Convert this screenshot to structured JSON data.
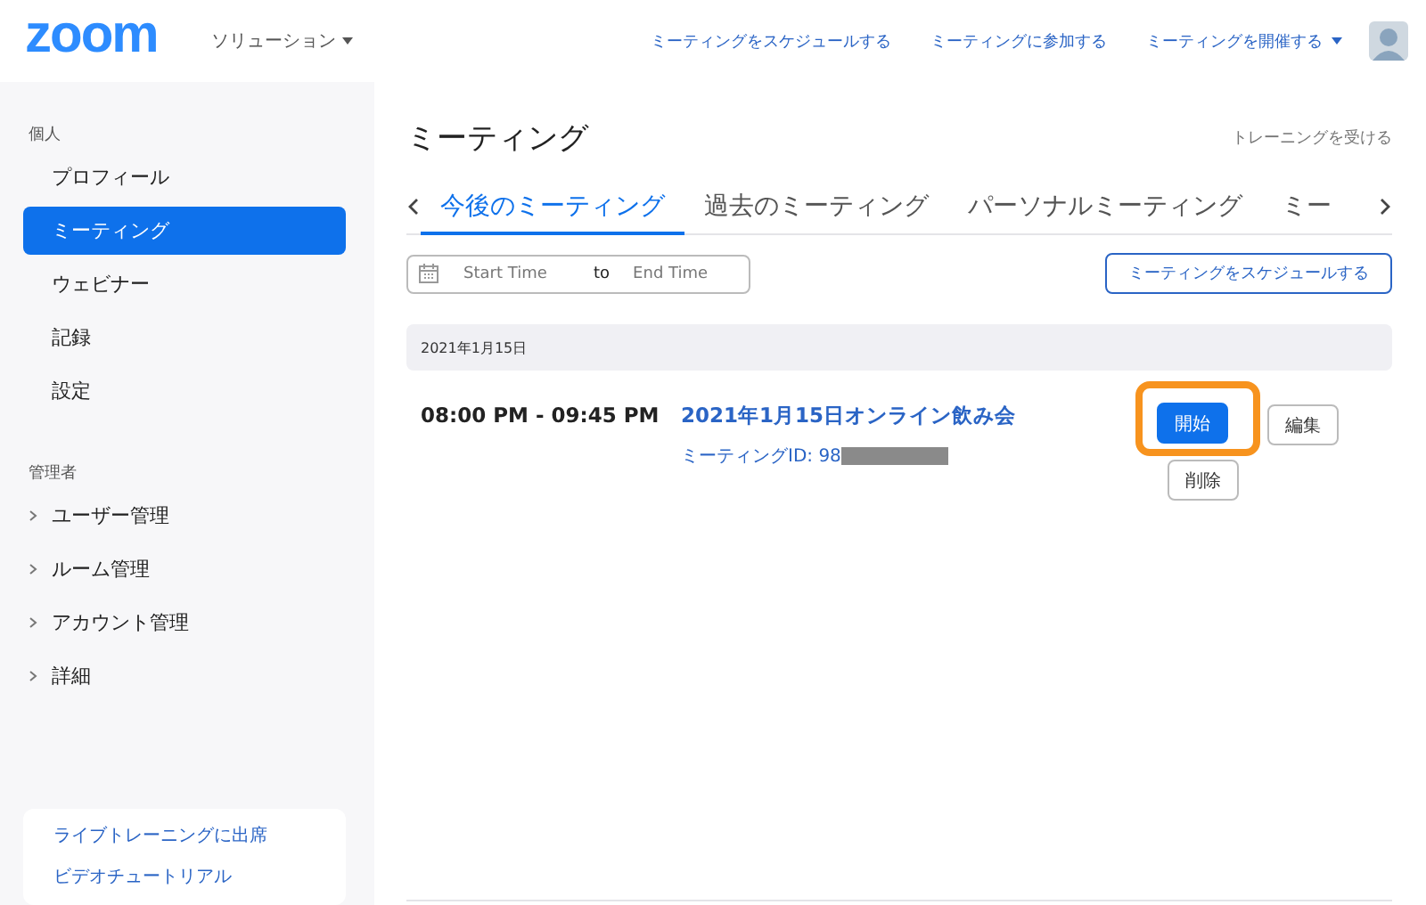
{
  "header": {
    "logo": "zoom",
    "solutions": "ソリューション",
    "nav": [
      {
        "label": "ミーティングをスケジュールする",
        "dropdown": false
      },
      {
        "label": "ミーティングに参加する",
        "dropdown": false
      },
      {
        "label": "ミーティングを開催する",
        "dropdown": true
      }
    ]
  },
  "sidebar": {
    "sections": [
      {
        "heading": "個人",
        "items": [
          {
            "label": "プロフィール",
            "selected": false,
            "expandable": false
          },
          {
            "label": "ミーティング",
            "selected": true,
            "expandable": false
          },
          {
            "label": "ウェビナー",
            "selected": false,
            "expandable": false
          },
          {
            "label": "記録",
            "selected": false,
            "expandable": false
          },
          {
            "label": "設定",
            "selected": false,
            "expandable": false
          }
        ]
      },
      {
        "heading": "管理者",
        "items": [
          {
            "label": "ユーザー管理",
            "selected": false,
            "expandable": true
          },
          {
            "label": "ルーム管理",
            "selected": false,
            "expandable": true
          },
          {
            "label": "アカウント管理",
            "selected": false,
            "expandable": true
          },
          {
            "label": "詳細",
            "selected": false,
            "expandable": true
          }
        ]
      }
    ],
    "links": [
      "ライブトレーニングに出席",
      "ビデオチュートリアル"
    ]
  },
  "main": {
    "title": "ミーティング",
    "training_link": "トレーニングを受ける",
    "tabs": [
      {
        "label": "今後のミーティング",
        "selected": true
      },
      {
        "label": "過去のミーティング",
        "selected": false
      },
      {
        "label": "パーソナルミーティング",
        "selected": false
      },
      {
        "label": "ミー",
        "selected": false
      }
    ],
    "date_range": {
      "start_placeholder": "Start Time",
      "separator": "to",
      "end_placeholder": "End Time"
    },
    "schedule_button": "ミーティングをスケジュールする",
    "groups": [
      {
        "date": "2021年1月15日",
        "meetings": [
          {
            "time": "08:00 PM - 09:45 PM",
            "title": "2021年1月15日オンライン飲み会",
            "meeting_id": "ミーティングID: 98",
            "id_redacted": true,
            "actions": [
              {
                "label": "開始",
                "kind": "primary",
                "highlighted": true
              },
              {
                "label": "編集",
                "kind": "secondary",
                "highlighted": false
              },
              {
                "label": "削除",
                "kind": "secondary",
                "highlighted": false
              }
            ]
          }
        ]
      }
    ]
  }
}
